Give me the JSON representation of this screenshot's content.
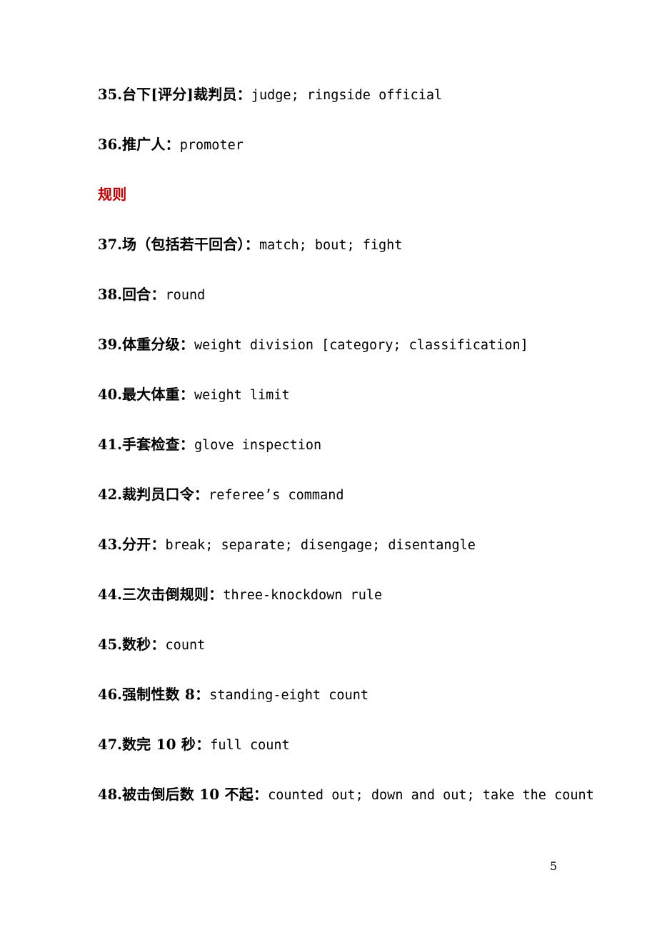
{
  "document": {
    "page_number": "5",
    "colors": {
      "text": "#000000",
      "heading_red": "#C00000",
      "background": "#FFFFFF"
    }
  },
  "entries": [
    {
      "type": "entry",
      "number": "35.",
      "chinese": "台下[评分]裁判员：",
      "english": "judge; ringside official"
    },
    {
      "type": "entry",
      "number": "36.",
      "chinese": "推广人：",
      "english": "promoter"
    },
    {
      "type": "heading",
      "chinese": "规则"
    },
    {
      "type": "entry",
      "number": "37.",
      "chinese": "场（包括若干回合）：",
      "english": "match; bout; fight"
    },
    {
      "type": "entry",
      "number": "38.",
      "chinese": "回合：",
      "english": "round"
    },
    {
      "type": "entry",
      "number": "39.",
      "chinese": "体重分级：",
      "english": "weight division [category; classification]"
    },
    {
      "type": "entry",
      "number": "40.",
      "chinese": "最大体重：",
      "english": "weight limit"
    },
    {
      "type": "entry",
      "number": "41.",
      "chinese": "手套检查：",
      "english": "glove inspection"
    },
    {
      "type": "entry",
      "number": "42.",
      "chinese": "裁判员口令：",
      "english": "referee’s command"
    },
    {
      "type": "entry",
      "number": "43.",
      "chinese": "分开：",
      "english": "break; separate; disengage; disentangle"
    },
    {
      "type": "entry",
      "number": "44.",
      "chinese": "三次击倒规则：",
      "english": "three-knockdown rule"
    },
    {
      "type": "entry",
      "number": "45.",
      "chinese": "数秒：",
      "english": "count"
    },
    {
      "type": "entry",
      "number": "46.",
      "chinese": "强制性数 8：",
      "english": "standing-eight count"
    },
    {
      "type": "entry",
      "number": "47.",
      "chinese": "数完 10 秒：",
      "english": "full count"
    },
    {
      "type": "entry",
      "number": "48.",
      "chinese": "被击倒后数 10 不起：",
      "english": "counted out; down and out; take the count"
    }
  ]
}
